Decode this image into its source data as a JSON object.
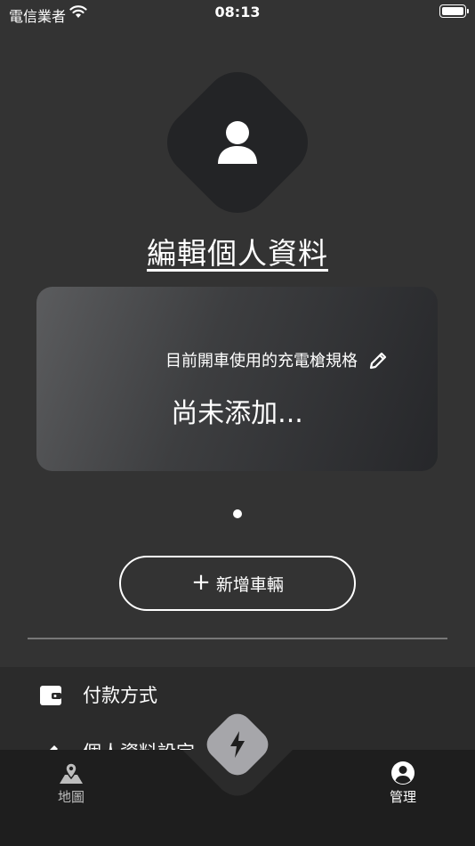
{
  "status_bar": {
    "carrier": "電信業者",
    "time": "08:13"
  },
  "profile": {
    "edit_label": "編輯個人資料"
  },
  "charger_card": {
    "label": "目前開車使用的充電槍規格",
    "value": "尚未添加..."
  },
  "add_vehicle": {
    "label": "新增車輛"
  },
  "menu": {
    "items": [
      {
        "label": "付款方式",
        "icon": "wallet-icon"
      },
      {
        "label": "個人資料設定",
        "icon": "pencil-icon"
      }
    ]
  },
  "bottom_nav": {
    "items": [
      {
        "label": "地圖",
        "icon": "map-pin-icon"
      },
      {
        "label": "管理",
        "icon": "account-circle-icon"
      }
    ],
    "center_icon": "lightning-bolt-icon"
  },
  "colors": {
    "background": "#333333",
    "card_start": "#5b5c5e",
    "card_end": "#26272a",
    "avatar_bg": "#232426",
    "nav_bg": "#1e1e1e",
    "center_button": "#a6a6aa"
  }
}
